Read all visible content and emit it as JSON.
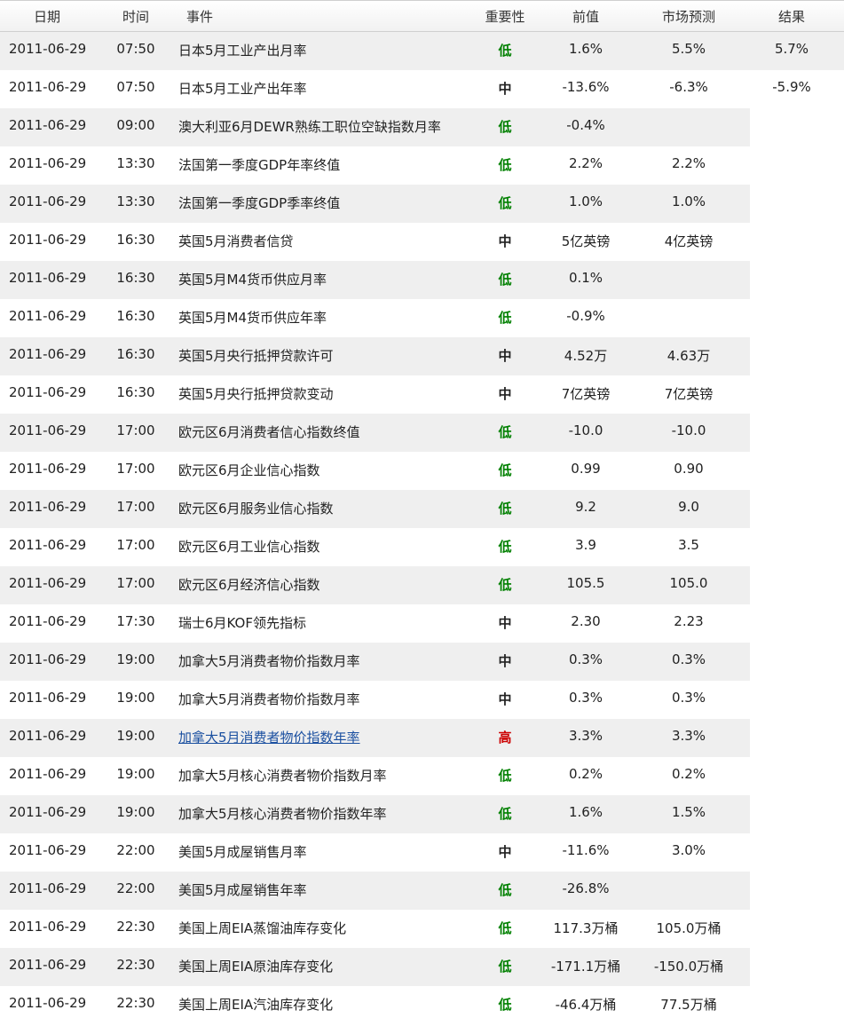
{
  "header": {
    "date": "日期",
    "time": "时间",
    "event": "事件",
    "importance": "重要性",
    "previous": "前值",
    "forecast": "市场预测",
    "result": "结果"
  },
  "colors": {
    "low": "#008000",
    "medium": "#0000cc",
    "high": "#cc0000",
    "row_shade": "#efefef",
    "link": "#1a4fa0"
  },
  "rows": [
    {
      "date": "2011-06-29",
      "time": "07:50",
      "event": "日本5月工业产出月率",
      "importance": "低",
      "level": "low",
      "previous": "1.6%",
      "forecast": "5.5%",
      "result": "5.7%"
    },
    {
      "date": "2011-06-29",
      "time": "07:50",
      "event": "日本5月工业产出年率",
      "importance": "中",
      "level": "medium",
      "previous": "-13.6%",
      "forecast": "-6.3%",
      "result": "-5.9%"
    },
    {
      "date": "2011-06-29",
      "time": "09:00",
      "event": "澳大利亚6月DEWR熟练工职位空缺指数月率",
      "importance": "低",
      "level": "low",
      "previous": "-0.4%",
      "forecast": "",
      "result": ""
    },
    {
      "date": "2011-06-29",
      "time": "13:30",
      "event": "法国第一季度GDP年率终值",
      "importance": "低",
      "level": "low",
      "previous": "2.2%",
      "forecast": "2.2%",
      "result": ""
    },
    {
      "date": "2011-06-29",
      "time": "13:30",
      "event": "法国第一季度GDP季率终值",
      "importance": "低",
      "level": "low",
      "previous": "1.0%",
      "forecast": "1.0%",
      "result": ""
    },
    {
      "date": "2011-06-29",
      "time": "16:30",
      "event": "英国5月消费者信贷",
      "importance": "中",
      "level": "medium",
      "previous": "5亿英镑",
      "forecast": "4亿英镑",
      "result": ""
    },
    {
      "date": "2011-06-29",
      "time": "16:30",
      "event": "英国5月M4货币供应月率",
      "importance": "低",
      "level": "low",
      "previous": "0.1%",
      "forecast": "",
      "result": ""
    },
    {
      "date": "2011-06-29",
      "time": "16:30",
      "event": "英国5月M4货币供应年率",
      "importance": "低",
      "level": "low",
      "previous": "-0.9%",
      "forecast": "",
      "result": ""
    },
    {
      "date": "2011-06-29",
      "time": "16:30",
      "event": "英国5月央行抵押贷款许可",
      "importance": "中",
      "level": "medium",
      "previous": "4.52万",
      "forecast": "4.63万",
      "result": ""
    },
    {
      "date": "2011-06-29",
      "time": "16:30",
      "event": "英国5月央行抵押贷款变动",
      "importance": "中",
      "level": "medium",
      "previous": "7亿英镑",
      "forecast": "7亿英镑",
      "result": ""
    },
    {
      "date": "2011-06-29",
      "time": "17:00",
      "event": "欧元区6月消费者信心指数终值",
      "importance": "低",
      "level": "low",
      "previous": "-10.0",
      "forecast": "-10.0",
      "result": ""
    },
    {
      "date": "2011-06-29",
      "time": "17:00",
      "event": "欧元区6月企业信心指数",
      "importance": "低",
      "level": "low",
      "previous": "0.99",
      "forecast": "0.90",
      "result": ""
    },
    {
      "date": "2011-06-29",
      "time": "17:00",
      "event": "欧元区6月服务业信心指数",
      "importance": "低",
      "level": "low",
      "previous": "9.2",
      "forecast": "9.0",
      "result": ""
    },
    {
      "date": "2011-06-29",
      "time": "17:00",
      "event": "欧元区6月工业信心指数",
      "importance": "低",
      "level": "low",
      "previous": "3.9",
      "forecast": "3.5",
      "result": ""
    },
    {
      "date": "2011-06-29",
      "time": "17:00",
      "event": "欧元区6月经济信心指数",
      "importance": "低",
      "level": "low",
      "previous": "105.5",
      "forecast": "105.0",
      "result": ""
    },
    {
      "date": "2011-06-29",
      "time": "17:30",
      "event": "瑞士6月KOF领先指标",
      "importance": "中",
      "level": "medium",
      "previous": "2.30",
      "forecast": "2.23",
      "result": ""
    },
    {
      "date": "2011-06-29",
      "time": "19:00",
      "event": "加拿大5月消费者物价指数月率",
      "importance": "中",
      "level": "medium",
      "previous": "0.3%",
      "forecast": "0.3%",
      "result": ""
    },
    {
      "date": "2011-06-29",
      "time": "19:00",
      "event": "加拿大5月消费者物价指数月率",
      "importance": "中",
      "level": "medium",
      "previous": "0.3%",
      "forecast": "0.3%",
      "result": ""
    },
    {
      "date": "2011-06-29",
      "time": "19:00",
      "event": "加拿大5月消费者物价指数年率",
      "importance": "高",
      "level": "high",
      "previous": "3.3%",
      "forecast": "3.3%",
      "result": "",
      "link": true
    },
    {
      "date": "2011-06-29",
      "time": "19:00",
      "event": "加拿大5月核心消费者物价指数月率",
      "importance": "低",
      "level": "low",
      "previous": "0.2%",
      "forecast": "0.2%",
      "result": ""
    },
    {
      "date": "2011-06-29",
      "time": "19:00",
      "event": "加拿大5月核心消费者物价指数年率",
      "importance": "低",
      "level": "low",
      "previous": "1.6%",
      "forecast": "1.5%",
      "result": ""
    },
    {
      "date": "2011-06-29",
      "time": "22:00",
      "event": "美国5月成屋销售月率",
      "importance": "中",
      "level": "medium",
      "previous": "-11.6%",
      "forecast": "3.0%",
      "result": ""
    },
    {
      "date": "2011-06-29",
      "time": "22:00",
      "event": "美国5月成屋销售年率",
      "importance": "低",
      "level": "low",
      "previous": "-26.8%",
      "forecast": "",
      "result": ""
    },
    {
      "date": "2011-06-29",
      "time": "22:30",
      "event": "美国上周EIA蒸馏油库存变化",
      "importance": "低",
      "level": "low",
      "previous": "117.3万桶",
      "forecast": "105.0万桶",
      "result": ""
    },
    {
      "date": "2011-06-29",
      "time": "22:30",
      "event": "美国上周EIA原油库存变化",
      "importance": "低",
      "level": "low",
      "previous": "-171.1万桶",
      "forecast": "-150.0万桶",
      "result": ""
    },
    {
      "date": "2011-06-29",
      "time": "22:30",
      "event": "美国上周EIA汽油库存变化",
      "importance": "低",
      "level": "low",
      "previous": "-46.4万桶",
      "forecast": "77.5万桶",
      "result": ""
    }
  ]
}
